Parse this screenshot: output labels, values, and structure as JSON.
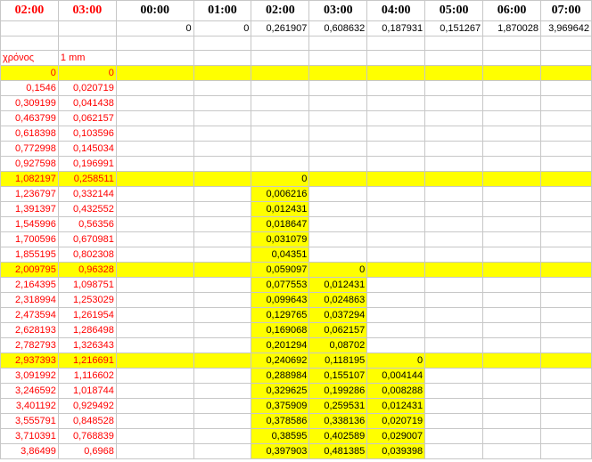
{
  "header_row": [
    "02:00",
    "03:00",
    "00:00",
    "01:00",
    "02:00",
    "03:00",
    "04:00",
    "05:00",
    "06:00",
    "07:00"
  ],
  "values_row": [
    "",
    "",
    "0",
    "0",
    "0,261907",
    "0,608632",
    "0,187931",
    "0,151267",
    "1,870028",
    "3,969642"
  ],
  "labels_row": [
    "χρόνος",
    "1 mm"
  ],
  "rows": [
    [
      "0",
      "0",
      "",
      "",
      "",
      "",
      "",
      "",
      "",
      ""
    ],
    [
      "0,1546",
      "0,020719",
      "",
      "",
      "",
      "",
      "",
      "",
      "",
      ""
    ],
    [
      "0,309199",
      "0,041438",
      "",
      "",
      "",
      "",
      "",
      "",
      "",
      ""
    ],
    [
      "0,463799",
      "0,062157",
      "",
      "",
      "",
      "",
      "",
      "",
      "",
      ""
    ],
    [
      "0,618398",
      "0,103596",
      "",
      "",
      "",
      "",
      "",
      "",
      "",
      ""
    ],
    [
      "0,772998",
      "0,145034",
      "",
      "",
      "",
      "",
      "",
      "",
      "",
      ""
    ],
    [
      "0,927598",
      "0,196991",
      "",
      "",
      "",
      "",
      "",
      "",
      "",
      ""
    ],
    [
      "1,082197",
      "0,258511",
      "",
      "",
      "0",
      "",
      "",
      "",
      "",
      ""
    ],
    [
      "1,236797",
      "0,332144",
      "",
      "",
      "0,006216",
      "",
      "",
      "",
      "",
      ""
    ],
    [
      "1,391397",
      "0,432552",
      "",
      "",
      "0,012431",
      "",
      "",
      "",
      "",
      ""
    ],
    [
      "1,545996",
      "0,56356",
      "",
      "",
      "0,018647",
      "",
      "",
      "",
      "",
      ""
    ],
    [
      "1,700596",
      "0,670981",
      "",
      "",
      "0,031079",
      "",
      "",
      "",
      "",
      ""
    ],
    [
      "1,855195",
      "0,802308",
      "",
      "",
      "0,04351",
      "",
      "",
      "",
      "",
      ""
    ],
    [
      "2,009795",
      "0,96328",
      "",
      "",
      "0,059097",
      "0",
      "",
      "",
      "",
      ""
    ],
    [
      "2,164395",
      "1,098751",
      "",
      "",
      "0,077553",
      "0,012431",
      "",
      "",
      "",
      ""
    ],
    [
      "2,318994",
      "1,253029",
      "",
      "",
      "0,099643",
      "0,024863",
      "",
      "",
      "",
      ""
    ],
    [
      "2,473594",
      "1,261954",
      "",
      "",
      "0,129765",
      "0,037294",
      "",
      "",
      "",
      ""
    ],
    [
      "2,628193",
      "1,286498",
      "",
      "",
      "0,169068",
      "0,062157",
      "",
      "",
      "",
      ""
    ],
    [
      "2,782793",
      "1,326343",
      "",
      "",
      "0,201294",
      "0,08702",
      "",
      "",
      "",
      ""
    ],
    [
      "2,937393",
      "1,216691",
      "",
      "",
      "0,240692",
      "0,118195",
      "0",
      "",
      "",
      ""
    ],
    [
      "3,091992",
      "1,116602",
      "",
      "",
      "0,288984",
      "0,155107",
      "0,004144",
      "",
      "",
      ""
    ],
    [
      "3,246592",
      "1,018744",
      "",
      "",
      "0,329625",
      "0,199286",
      "0,008288",
      "",
      "",
      ""
    ],
    [
      "3,401192",
      "0,929492",
      "",
      "",
      "0,375909",
      "0,259531",
      "0,012431",
      "",
      "",
      ""
    ],
    [
      "3,555791",
      "0,848528",
      "",
      "",
      "0,378586",
      "0,338136",
      "0,020719",
      "",
      "",
      ""
    ],
    [
      "3,710391",
      "0,768839",
      "",
      "",
      "0,38595",
      "0,402589",
      "0,029007",
      "",
      "",
      ""
    ],
    [
      "3,86499",
      "0,6968",
      "",
      "",
      "0,397903",
      "0,481385",
      "0,039398",
      "",
      "",
      ""
    ]
  ],
  "colors": {
    "highlight": "#ffff00",
    "red_text": "#ff0000",
    "grid": "#c7c7c7"
  }
}
